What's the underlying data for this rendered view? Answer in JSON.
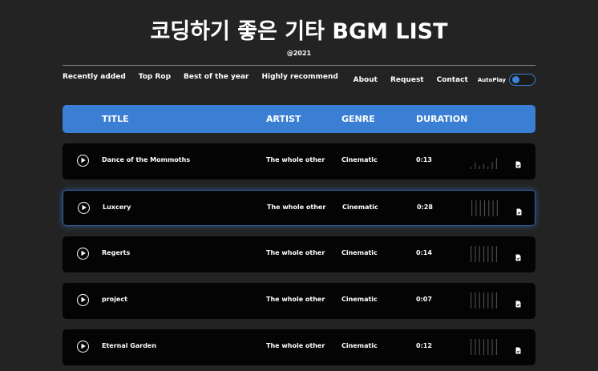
{
  "app": {
    "title": "코딩하기 좋은 기타 BGM LIST",
    "year": "@2021"
  },
  "nav": {
    "left": [
      "Recently added",
      "Top Rop",
      "Best of the year",
      "Highly recommend"
    ],
    "right": [
      "About",
      "Request",
      "Contact"
    ],
    "autoplay_label": "AutoPlay"
  },
  "table": {
    "headers": {
      "title": "TITLE",
      "artist": "ARTIST",
      "genre": "GENRE",
      "duration": "DURATION"
    },
    "rows": [
      {
        "title": "Dance of the Mommoths",
        "artist": "The whole other",
        "genre": "Cinematic",
        "duration": "0:13",
        "active": false
      },
      {
        "title": "Luxcery",
        "artist": "The whole other",
        "genre": "Cinematic",
        "duration": "0:28",
        "active": true
      },
      {
        "title": "Regerts",
        "artist": "The whole other",
        "genre": "Cinematic",
        "duration": "0:14",
        "active": false
      },
      {
        "title": "project",
        "artist": "The whole other",
        "genre": "Cinematic",
        "duration": "0:07",
        "active": false
      },
      {
        "title": "Eternal Garden",
        "artist": "The whole other",
        "genre": "Cinematic",
        "duration": "0:12",
        "active": false
      }
    ]
  },
  "colors": {
    "accent": "#3b7fd4",
    "background": "#232323",
    "row": "#040404"
  },
  "icons": {
    "row_play": "play-circle-icon",
    "row_file": "file-icon"
  }
}
